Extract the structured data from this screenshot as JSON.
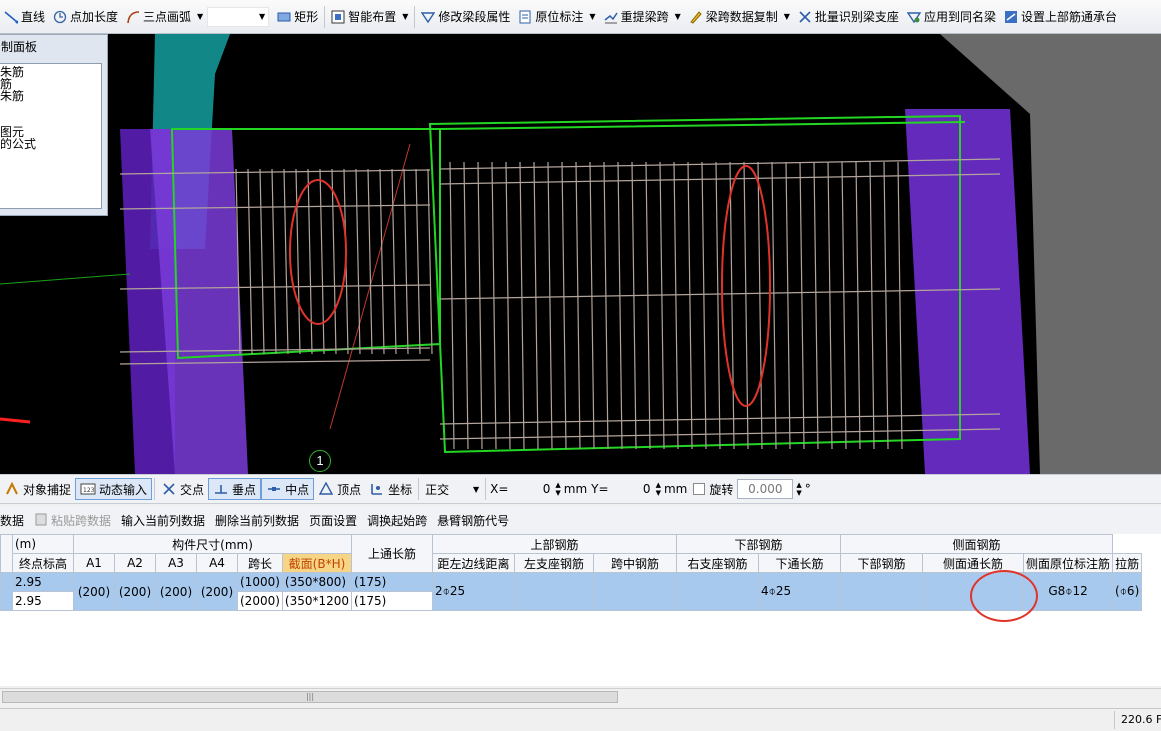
{
  "toolbar": {
    "items": [
      {
        "label": "直线",
        "icon": "line-icon"
      },
      {
        "label": "点加长度",
        "icon": "point-length-icon"
      },
      {
        "label": "三点画弧",
        "icon": "arc-icon"
      },
      {
        "label": "矩形",
        "icon": "rectangle-icon"
      },
      {
        "label": "智能布置",
        "icon": "smart-layout-icon"
      },
      {
        "label": "修改梁段属性",
        "icon": "beam-property-icon"
      },
      {
        "label": "原位标注",
        "icon": "in-situ-mark-icon"
      },
      {
        "label": "重提梁跨",
        "icon": "re-extract-span-icon"
      },
      {
        "label": "梁跨数据复制",
        "icon": "copy-span-data-icon"
      },
      {
        "label": "批量识别梁支座",
        "icon": "batch-support-icon"
      },
      {
        "label": "应用到同名梁",
        "icon": "apply-same-name-icon"
      },
      {
        "label": "设置上部筋通承台",
        "icon": "set-top-rebar-icon"
      }
    ]
  },
  "panel": {
    "title": "制面板",
    "items": [
      "朱筋",
      "筋",
      "朱筋",
      "",
      "",
      "图元",
      "的公式"
    ]
  },
  "viewport": {
    "axis_label": "1",
    "colors": {
      "background": "#000000",
      "beam_outline": "#22d622",
      "rebar": "#b2a49b",
      "column": "#7a3bd9",
      "annotation": "#e0332a"
    }
  },
  "snapbar": {
    "object_snap": "对象捕捉",
    "dynamic_input": "动态输入",
    "intersection": "交点",
    "perpendicular": "垂点",
    "midpoint": "中点",
    "vertex": "顶点",
    "coordinate": "坐标",
    "ortho": "正交",
    "x_label": "X=",
    "x_value": "0",
    "y_label": "Y=",
    "y_value": "0",
    "unit": "mm",
    "rotate_label": "旋转",
    "rotate_value": "0.000",
    "degree": "°"
  },
  "table_toolbar": {
    "items": [
      "数据",
      "粘贴跨数据",
      "输入当前列数据",
      "删除当前列数据",
      "页面设置",
      "调换起始跨",
      "悬臂钢筋代号"
    ]
  },
  "grid": {
    "headers": {
      "unit": "(m)",
      "member_size": "构件尺寸(mm)",
      "top_rebar": "上部钢筋",
      "bottom_rebar": "下部钢筋",
      "side_rebar": "侧面钢筋",
      "top_through": "上通长筋",
      "end_elevation": "终点标高",
      "a1": "A1",
      "a2": "A2",
      "a3": "A3",
      "a4": "A4",
      "span_length": "跨长",
      "section": "截面(B*H)",
      "left_edge_dist": "距左边线距离",
      "left_support": "左支座钢筋",
      "mid_span": "跨中钢筋",
      "right_support": "右支座钢筋",
      "bottom_through": "下通长筋",
      "bottom_bar": "下部钢筋",
      "side_through": "侧面通长筋",
      "side_in_situ": "侧面原位标注筋",
      "tie_bar": "拉筋"
    },
    "rows": {
      "elev_1": "2.95",
      "elev_2": "2.95",
      "a1": "(200)",
      "a2": "(200)",
      "a3": "(200)",
      "a4": "(200)",
      "span_1": "(1000)",
      "span_2": "(2000)",
      "section_1": "(350*800)",
      "section_2": "(350*1200",
      "dist_1": "(175)",
      "dist_2": "(175)",
      "top_through": "2⌽25",
      "bottom_through": "4⌽25",
      "side_in_situ": "G8⌽12",
      "tie_bar": "(⌽6)"
    }
  },
  "statusbar": {
    "value": "220.6 F"
  }
}
